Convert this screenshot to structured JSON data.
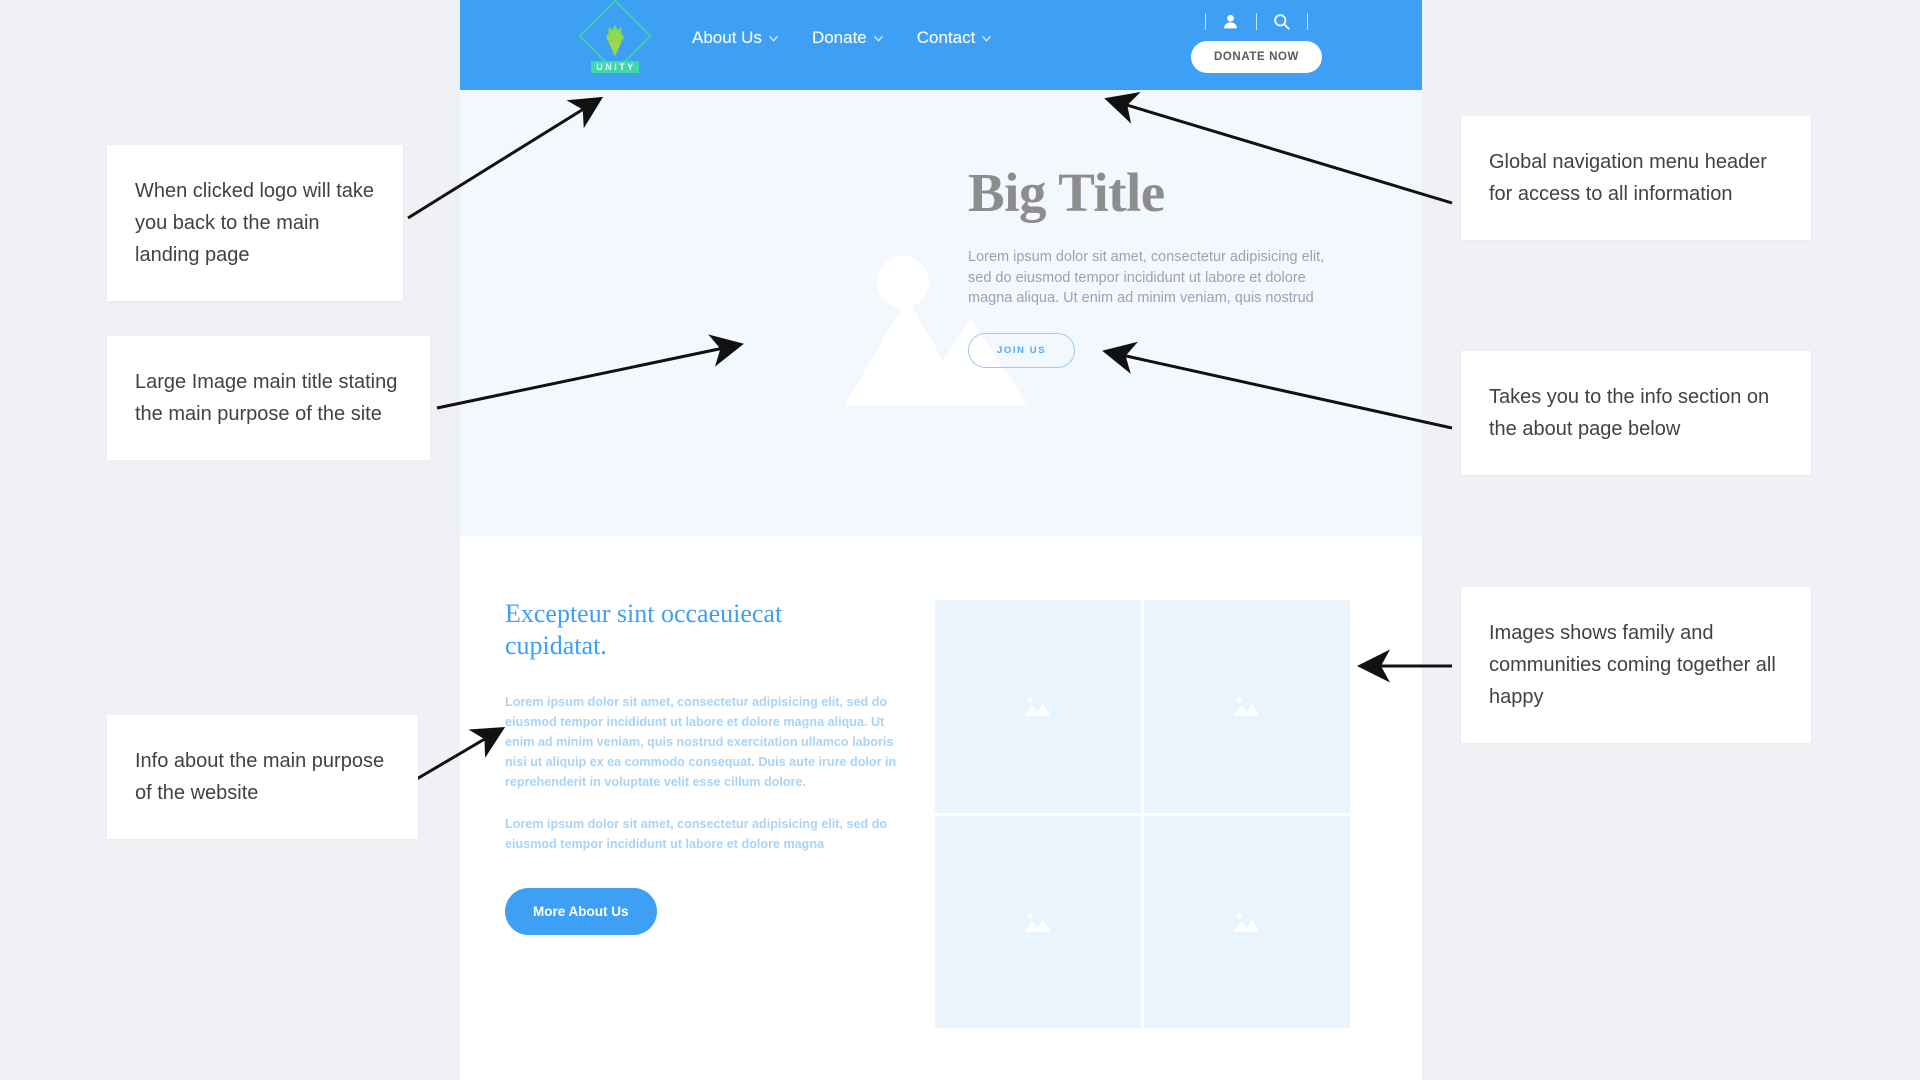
{
  "site": {
    "logo": {
      "text": "UNITY",
      "name": "unity-logo"
    },
    "nav": {
      "links": [
        {
          "label": "About Us",
          "has_dropdown": true
        },
        {
          "label": "Donate",
          "has_dropdown": true
        },
        {
          "label": "Contact",
          "has_dropdown": true
        }
      ],
      "account_icon": "user-icon",
      "search_icon": "search-icon",
      "donate_button": "DONATE NOW"
    },
    "hero": {
      "title": "Big Title",
      "body": "Lorem ipsum dolor sit amet, consectetur adipisicing elit, sed do eiusmod tempor incididunt ut labore et dolore magna aliqua. Ut enim ad minim veniam, quis nostrud",
      "cta": "JOIN US",
      "image_placeholder": "mountain-sun-image-placeholder"
    },
    "about": {
      "heading": "Excepteur sint occaeuiecat cupidatat.",
      "paragraph1": "Lorem ipsum dolor sit amet, consectetur adipisicing elit, sed do eiusmod tempor incididunt ut labore et dolore magna aliqua. Ut enim ad minim veniam, quis nostrud exercitation ullamco laboris nisi ut aliquip ex ea commodo consequat. Duis aute irure dolor in reprehenderit in voluptate velit esse cillum dolore.",
      "paragraph2": "Lorem ipsum dolor sit amet, consectetur adipisicing elit, sed do eiusmod tempor incididunt ut labore et dolore magna",
      "button": "More About Us",
      "gallery": [
        "image-placeholder-1",
        "image-placeholder-2",
        "image-placeholder-3",
        "image-placeholder-4"
      ]
    }
  },
  "annotations": [
    {
      "id": "logo-note",
      "text": "When clicked logo will take you back to the main landing page"
    },
    {
      "id": "hero-title-note",
      "text": "Large Image main title stating the main purpose of the site"
    },
    {
      "id": "about-info-note",
      "text": "Info about the main purpose of the website"
    },
    {
      "id": "nav-note",
      "text": "Global navigation menu header for access to all information"
    },
    {
      "id": "join-note",
      "text": "Takes you to the info section on the about page below"
    },
    {
      "id": "gallery-note",
      "text": "Images shows family and communities coming together all happy"
    }
  ],
  "colors": {
    "brand_blue": "#3da0f5",
    "hero_bg": "#f2f8fe",
    "page_bg": "#f0f1f5",
    "logo_green": "#3fd6a0",
    "body_text_blue": "#a8d4f7",
    "title_gray": "#8d8d8d"
  }
}
